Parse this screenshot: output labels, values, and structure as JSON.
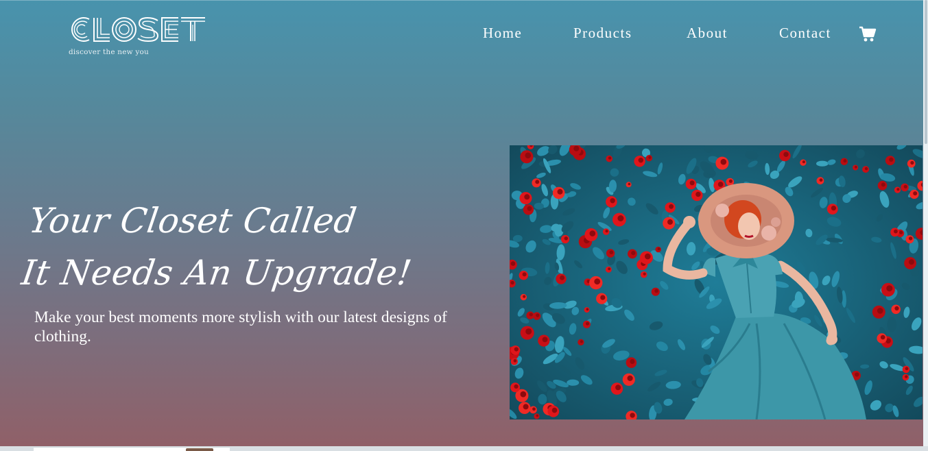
{
  "brand": {
    "logo_text": "CLOSET",
    "tagline": "discover the new you"
  },
  "nav": {
    "items": [
      {
        "label": "Home"
      },
      {
        "label": "Products"
      },
      {
        "label": "About"
      },
      {
        "label": "Contact"
      }
    ],
    "cart_icon": "shopping-cart-icon"
  },
  "hero": {
    "headline_line1": "Your Closet Called",
    "headline_line2": "It Needs An Upgrade!",
    "subtext": "Make your best moments more stylish with our latest designs of clothing.",
    "image_icon": "woman-in-roses-photo"
  },
  "colors": {
    "gradient_top": "#4893ad",
    "gradient_bottom": "#906068",
    "text": "#ffffff"
  }
}
